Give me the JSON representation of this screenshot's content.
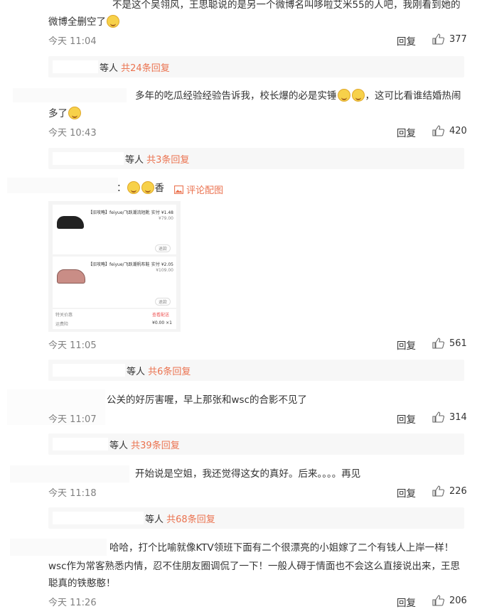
{
  "comments": [
    {
      "text_line1": "不是这个吴翎风，王思聪说的是另一个微博名叫哆啦艾米55的人吧，我刚看到她的",
      "text_line2": "微博全删空了",
      "time": "今天 11:04",
      "reply": "回复",
      "likes": "377",
      "sub": {
        "suffix": "等人",
        "count": "共24条回复"
      }
    },
    {
      "text_line1": "多年的吃瓜经验经验告诉我，校长爆的必是实锤",
      "text_line1b": "，这可比看谁结婚热闹",
      "text_line2": "多了",
      "time": "今天 10:43",
      "reply": "回复",
      "likes": "420",
      "sub": {
        "suffix": "等人",
        "count": "共3条回复"
      }
    },
    {
      "text_line1": "：",
      "text_line1b": "香",
      "pic_label": "评论配图",
      "time": "今天 11:05",
      "reply": "回复",
      "likes": "561",
      "sub": {
        "suffix": "等人",
        "count": "共6条回复"
      }
    },
    {
      "text_line1": "公关的好厉害喔，早上那张和wsc的合影不见了",
      "time": "今天 11:07",
      "reply": "回复",
      "likes": "314",
      "sub": {
        "suffix": "等人",
        "count": "共39条回复"
      }
    },
    {
      "text_line1": "开始说是空姐，我还觉得这女的真好。后来。。。。再见",
      "time": "今天 11:18",
      "reply": "回复",
      "likes": "226",
      "sub": {
        "suffix": "等人",
        "count": "共68条回复"
      }
    },
    {
      "text_line1": "哈哈，打个比喻就像KTV领班下面有二个很漂亮的小姐嫁了二个有钱人上岸一样！",
      "text_line2": "wsc作为常客熟悉内情，忍不住朋友圈调侃了一下！一般人碍于情面也不会这么直接说出来，王思",
      "text_line3": "聪真的铁憨憨！",
      "time": "今天 11:26",
      "reply": "回复",
      "likes": "206"
    }
  ],
  "screenshot": {
    "item1_title": "【旧攻略】feiyue/飞跃潮流短靴",
    "item1_price": "实付 ¥1.48",
    "item1_orig": "¥79.00",
    "item1_btn": "退款",
    "item2_title": "【旧攻略】feiyue/飞跃潮帆布鞋",
    "item2_price": "实付 ¥2.05",
    "item2_orig": "¥109.00",
    "item2_btn": "退款",
    "f1_label": "特关价惠",
    "f1_val": "查看配送",
    "f2_label": "运费险",
    "f2_val": "¥0.00 ×1"
  }
}
